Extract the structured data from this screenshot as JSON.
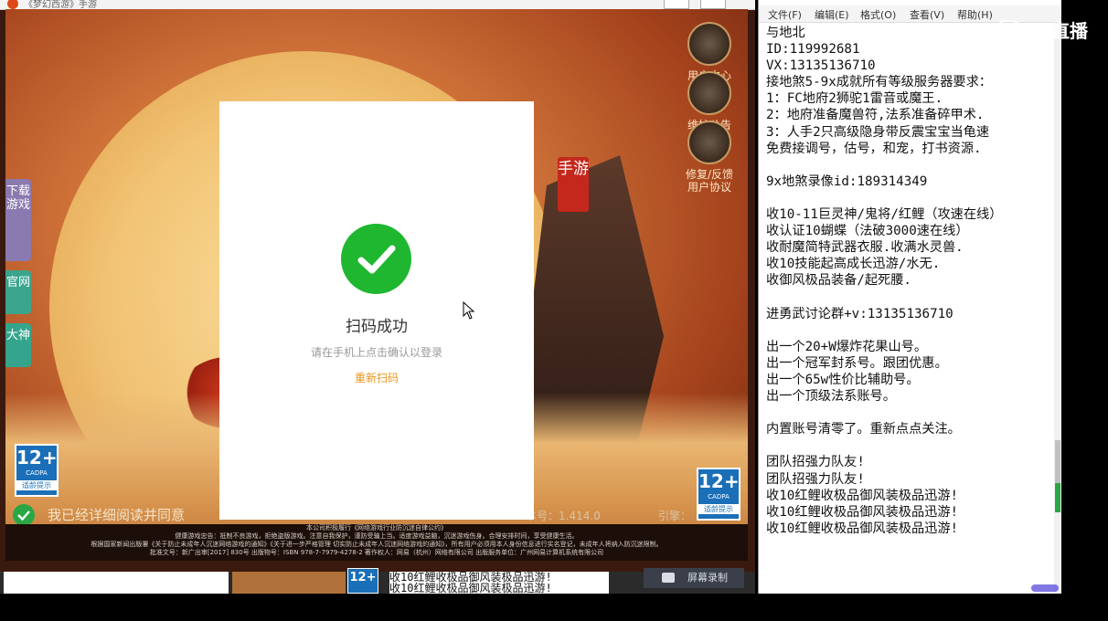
{
  "game": {
    "title": "《梦幻西游》手游",
    "side_tabs": {
      "download": "下载游戏",
      "official": "官网",
      "dashen": "大神"
    },
    "right_icons": [
      "用户中心",
      "维护公告",
      "修复/反馈",
      "用户协议"
    ],
    "badge": "手游",
    "cadpa": {
      "age": "12+",
      "org": "CADPA",
      "tip": "适龄提示"
    },
    "agree_text": "我已经详细阅读并同意",
    "version_text": "本号：1.414.0",
    "bless_text": "引擎：",
    "footer": [
      "本公司积极履行《网络游戏行业防沉迷自律公约》",
      "健康游戏忠告：抵制不良游戏，拒绝盗版游戏。注意自我保护，谨防受骗上当。适度游戏益脑，沉迷游戏伤身。合理安排时间，享受健康生活。",
      "根据国家新闻出版署《关于防止未成年人沉迷网络游戏的通知》《关于进一步严格管理 切实防止未成年人沉迷网络游戏的通知》，所有用户必须用本人身份信息进行实名登记，未成年人将纳入防沉迷限制。",
      "批准文号：新广出审[2017] 830号  出版物号：ISBN 978-7-7979-4278-2  著作权人：网易（杭州）网络有限公司  出版服务单位：广州网易计算机系统有限公司"
    ]
  },
  "qr": {
    "success": "扫码成功",
    "hint": "请在手机上点击确认以登录",
    "rescan": "重新扫码"
  },
  "notepad": {
    "menu": [
      "文件(F)",
      "编辑(E)",
      "格式(O)",
      "查看(V)",
      "帮助(H)"
    ],
    "text": "与地北\nID:119992681\nVX:13135136710\n接地煞5-9x成就所有等级服务器要求：\n1：FC地府2狮驼1雷音或魔王.\n2：地府准备魔兽符,法系准备碎甲术.\n3：人手2只高级隐身带反震宝宝当龟速\n免费接调号，估号，和宠，打书资源.\n\n9x地煞录像id:189314349\n\n收10-11巨灵神/鬼将/红鲤（攻速在线）\n收认证10蝴蝶（法破3000速在线）\n收耐魔简特武器衣服.收满水灵兽.\n收10技能起高成长迅游/水无.\n收御风极品装备/起死腰.\n\n进勇武讨论群+v:13135136710\n\n出一个20+W爆炸花果山号。\n出一个冠军封系号。跟团优惠。\n出一个65w性价比辅助号。\n出一个顶级法系账号。\n\n内置账号清零了。重新点点关注。\n\n团队招强力队友!\n团队招强力队友!\n收10红鲤收极品御风装极品迅游!\n收10红鲤收极品御风装极品迅游!\n收10红鲤收极品御风装极品迅游!"
  },
  "taskbar": {
    "notepad_preview": "收10红鲤收极品御风装极品迅游!\n收10红鲤收极品御风装极品迅游!",
    "record_label": "屏幕录制",
    "cadpa": "12+"
  },
  "stream": {
    "logo": "直播"
  }
}
